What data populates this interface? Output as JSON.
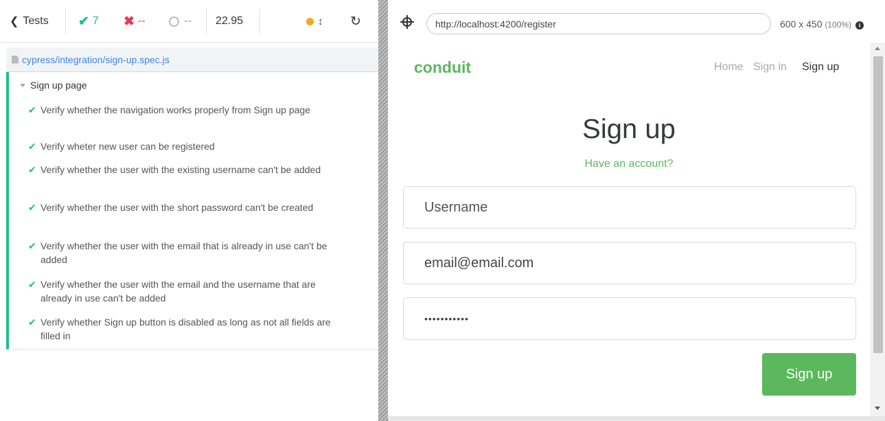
{
  "reporter": {
    "tests_button": "Tests",
    "passed_count": "7",
    "failed_count": "--",
    "pending_count": "--",
    "duration": "22.95",
    "spec_path": "cypress/integration/sign-up.spec.js",
    "suite_title": "Sign up page",
    "tests": [
      {
        "title": "Verify whether the navigation works properly from Sign up page"
      },
      {
        "title": "Verify wheter new user can be registered"
      },
      {
        "title": "Verify whether the user with the existing username can't be added"
      },
      {
        "title": "Verify whether the user with the short password can't be created"
      },
      {
        "title": "Verify whether the user with the email that is already in use can't be added"
      },
      {
        "title": "Verify whether the user with the email and the username that are already in use can't be added"
      },
      {
        "title": "Verify whether Sign up button is disabled as long as not all fields are filled in"
      }
    ]
  },
  "aut": {
    "url": "http://localhost:4200/register",
    "viewport": "600 x 450",
    "zoom": "(100%)"
  },
  "app": {
    "brand": "conduit",
    "nav": {
      "home": "Home",
      "sign_in": "Sign in",
      "sign_up": "Sign up"
    },
    "title": "Sign up",
    "have_account": "Have an account?",
    "username_placeholder": "Username",
    "email_value": "email@email.com",
    "password_mask": "•••••••••••",
    "submit_label": "Sign up"
  },
  "colors": {
    "pass": "#1fbf86",
    "brand": "#5cb85c",
    "fail": "#e8384f",
    "running": "#f5a623"
  }
}
